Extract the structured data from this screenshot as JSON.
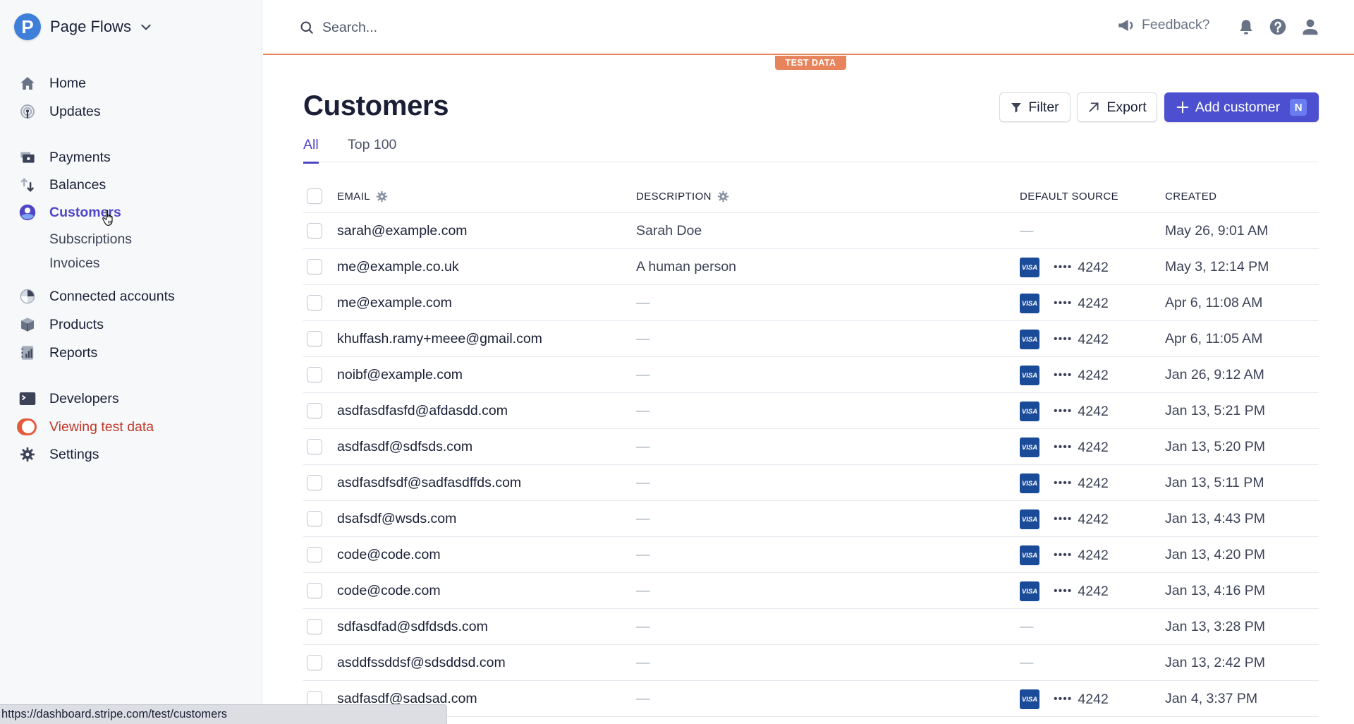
{
  "brand": {
    "name": "Page Flows",
    "logo_letter": "P"
  },
  "sidebar": {
    "items": [
      {
        "label": "Home",
        "icon": "home-icon"
      },
      {
        "label": "Updates",
        "icon": "broadcast-icon"
      },
      {
        "label": "Payments",
        "icon": "payments-icon"
      },
      {
        "label": "Balances",
        "icon": "balances-icon"
      },
      {
        "label": "Customers",
        "icon": "customer-icon",
        "active": true
      },
      {
        "label": "Connected accounts",
        "icon": "connected-accounts-icon"
      },
      {
        "label": "Products",
        "icon": "box-icon"
      },
      {
        "label": "Reports",
        "icon": "reports-icon"
      },
      {
        "label": "Developers",
        "icon": "terminal-icon"
      },
      {
        "label": "Viewing test data",
        "icon": "toggle-icon"
      },
      {
        "label": "Settings",
        "icon": "gear-icon"
      }
    ],
    "subitems": [
      {
        "label": "Subscriptions"
      },
      {
        "label": "Invoices"
      }
    ]
  },
  "header": {
    "search_placeholder": "Search...",
    "feedback_label": "Feedback?",
    "test_badge": "TEST DATA"
  },
  "page": {
    "title": "Customers",
    "filter_label": "Filter",
    "export_label": "Export",
    "add_label": "Add customer",
    "add_shortcut": "N",
    "tabs": [
      {
        "label": "All",
        "active": true
      },
      {
        "label": "Top 100",
        "active": false
      }
    ]
  },
  "table": {
    "columns": [
      "EMAIL",
      "DESCRIPTION",
      "DEFAULT SOURCE",
      "CREATED"
    ],
    "rows": [
      {
        "email": "sarah@example.com",
        "description": "Sarah Doe",
        "source": null,
        "created": "May 26, 9:01 AM"
      },
      {
        "email": "me@example.co.uk",
        "description": "A human person",
        "source": {
          "brand": "VISA",
          "dots": "••••",
          "last4": "4242"
        },
        "created": "May 3, 12:14 PM"
      },
      {
        "email": "me@example.com",
        "description": null,
        "source": {
          "brand": "VISA",
          "dots": "••••",
          "last4": "4242"
        },
        "created": "Apr 6, 11:08 AM"
      },
      {
        "email": "khuffash.ramy+meee@gmail.com",
        "description": null,
        "source": {
          "brand": "VISA",
          "dots": "••••",
          "last4": "4242"
        },
        "created": "Apr 6, 11:05 AM"
      },
      {
        "email": "noibf@example.com",
        "description": null,
        "source": {
          "brand": "VISA",
          "dots": "••••",
          "last4": "4242"
        },
        "created": "Jan 26, 9:12 AM"
      },
      {
        "email": "asdfasdfasfd@afdasdd.com",
        "description": null,
        "source": {
          "brand": "VISA",
          "dots": "••••",
          "last4": "4242"
        },
        "created": "Jan 13, 5:21 PM"
      },
      {
        "email": "asdfasdf@sdfsds.com",
        "description": null,
        "source": {
          "brand": "VISA",
          "dots": "••••",
          "last4": "4242"
        },
        "created": "Jan 13, 5:20 PM"
      },
      {
        "email": "asdfasdfsdf@sadfasdffds.com",
        "description": null,
        "source": {
          "brand": "VISA",
          "dots": "••••",
          "last4": "4242"
        },
        "created": "Jan 13, 5:11 PM"
      },
      {
        "email": "dsafsdf@wsds.com",
        "description": null,
        "source": {
          "brand": "VISA",
          "dots": "••••",
          "last4": "4242"
        },
        "created": "Jan 13, 4:43 PM"
      },
      {
        "email": "code@code.com",
        "description": null,
        "source": {
          "brand": "VISA",
          "dots": "••••",
          "last4": "4242"
        },
        "created": "Jan 13, 4:20 PM"
      },
      {
        "email": "code@code.com",
        "description": null,
        "source": {
          "brand": "VISA",
          "dots": "••••",
          "last4": "4242"
        },
        "created": "Jan 13, 4:16 PM"
      },
      {
        "email": "sdfasdfad@sdfdsds.com",
        "description": null,
        "source": null,
        "created": "Jan 13, 3:28 PM"
      },
      {
        "email": "asddfssddsf@sdsddsd.com",
        "description": null,
        "source": null,
        "created": "Jan 13, 2:42 PM"
      },
      {
        "email": "sadfasdf@sadsad.com",
        "description": null,
        "source": {
          "brand": "VISA",
          "dots": "••••",
          "last4": "4242"
        },
        "created": "Jan 4, 3:37 PM"
      }
    ],
    "empty_placeholder": "—"
  },
  "statusbar": {
    "url": "https://dashboard.stripe.com/test/customers"
  },
  "colors": {
    "accent": "#5046c8",
    "primary_button": "#4c4fcf",
    "test_mode": "#e8845c",
    "visa": "#1a4b99"
  }
}
